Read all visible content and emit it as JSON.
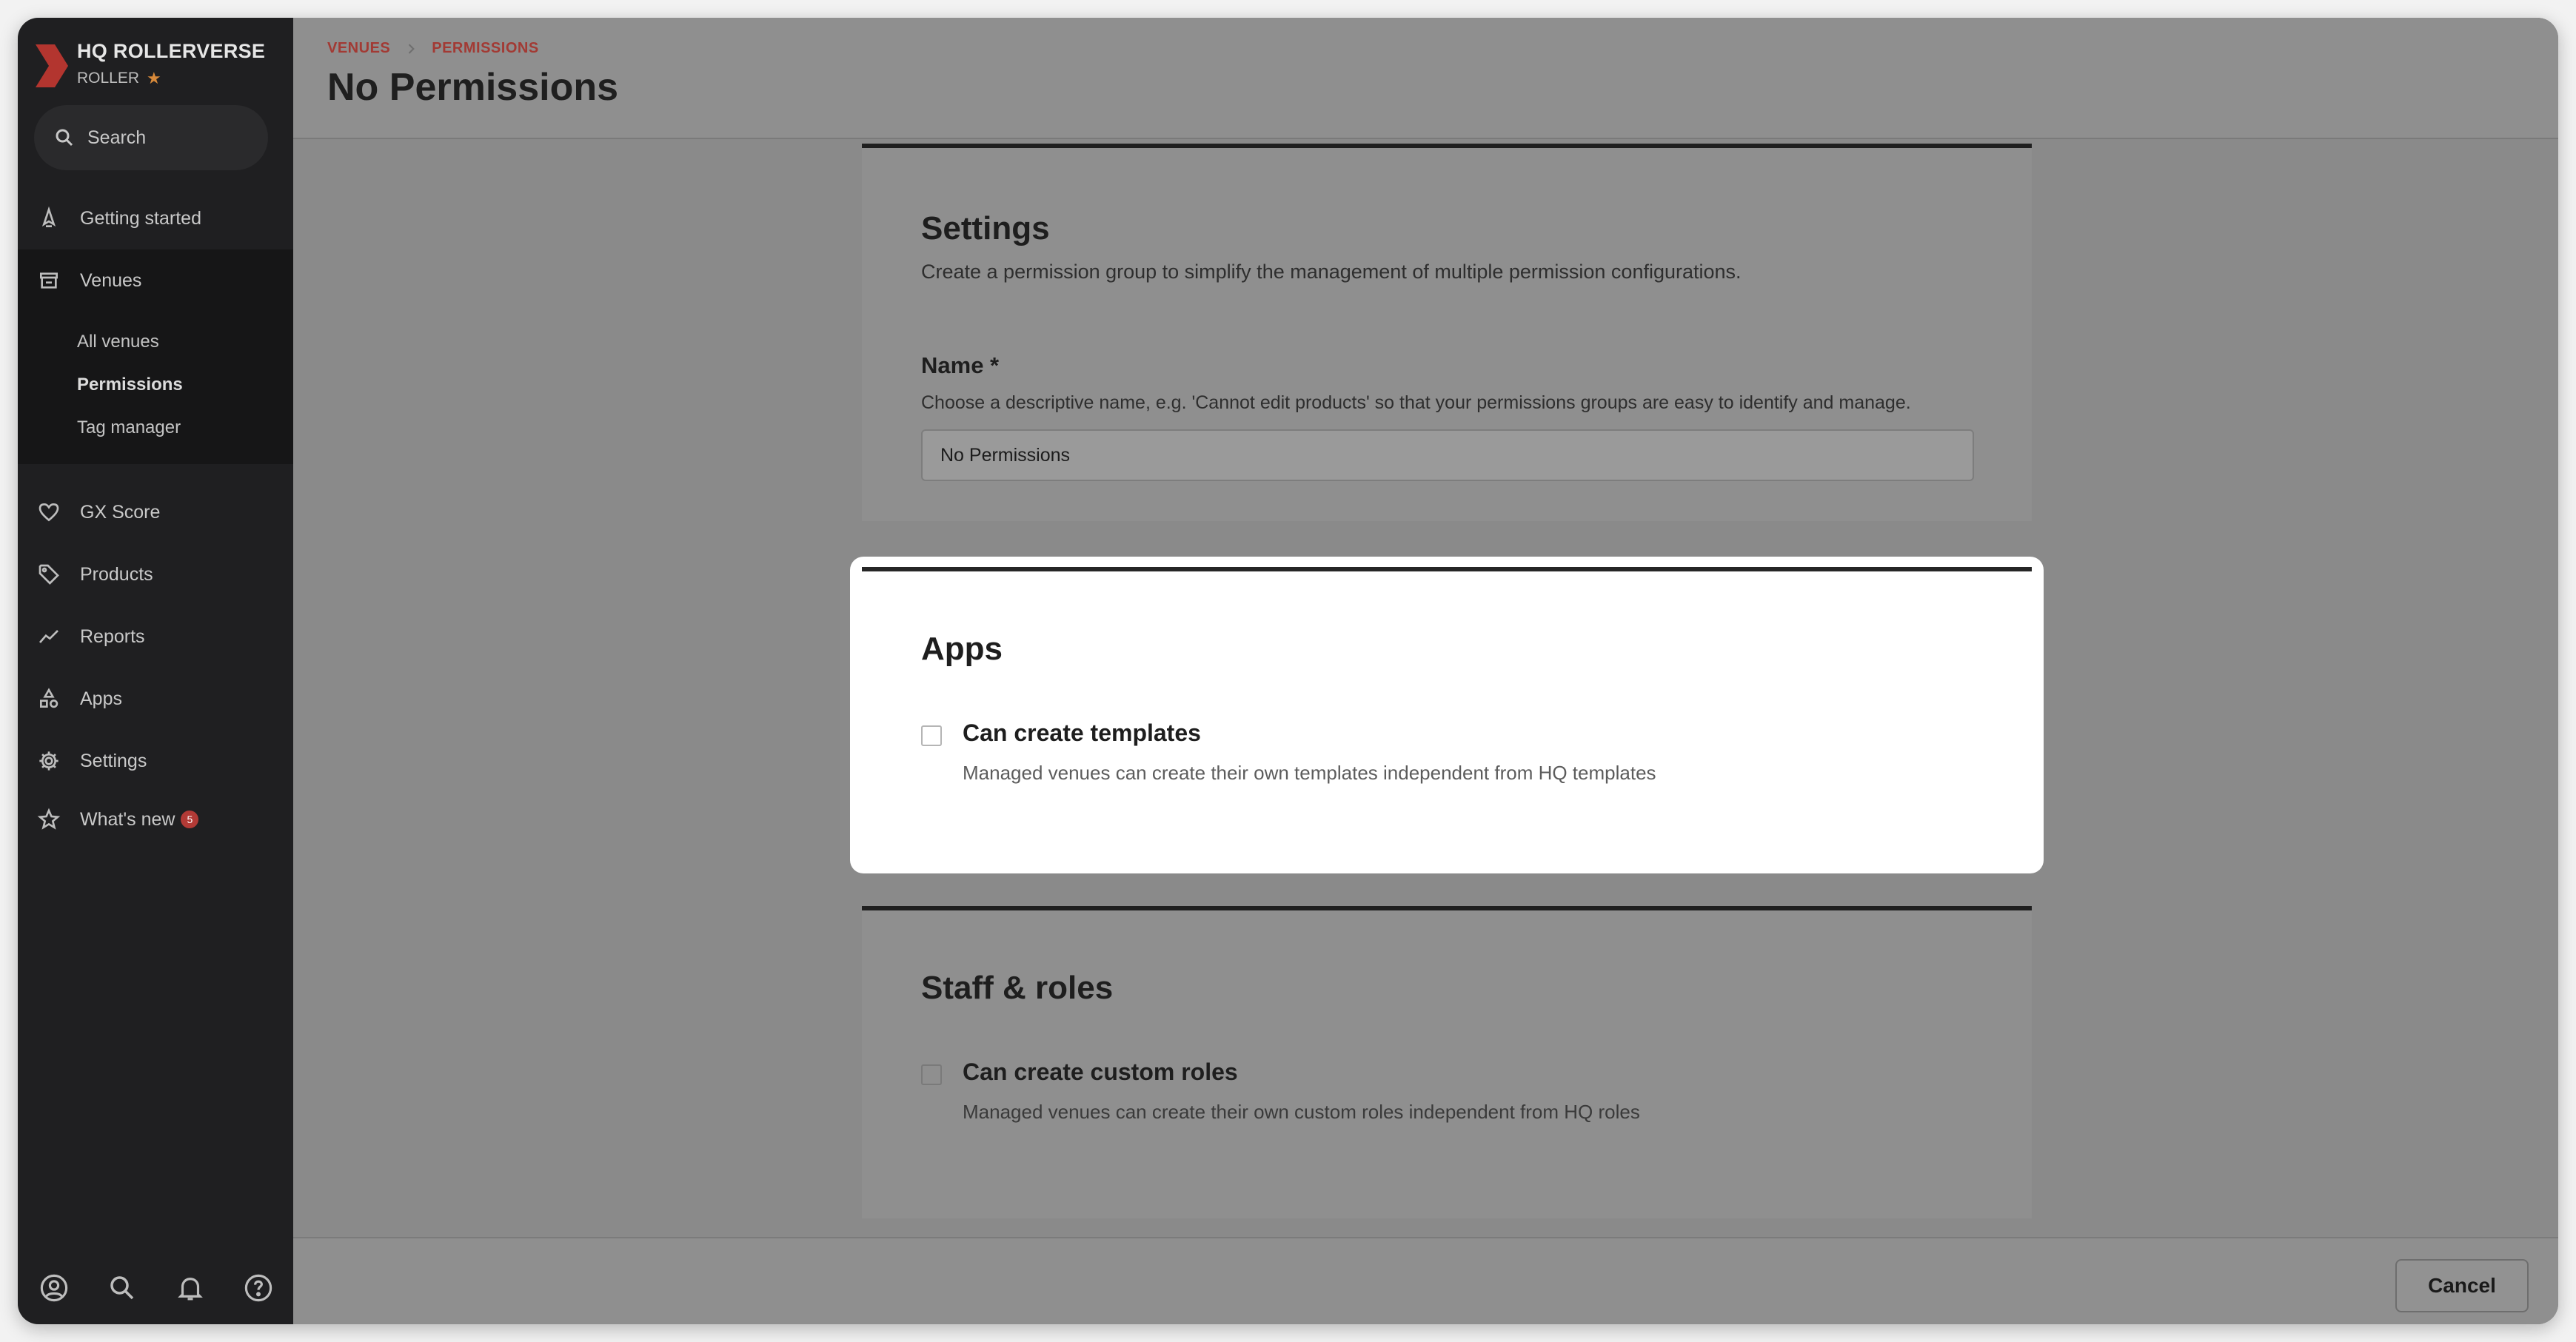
{
  "brand": {
    "name": "HQ ROLLERVERSE",
    "sub": "ROLLER"
  },
  "search": {
    "placeholder": "Search"
  },
  "nav": {
    "getting_started": "Getting started",
    "venues": "Venues",
    "venues_sub": [
      "All venues",
      "Permissions",
      "Tag manager"
    ],
    "gx_score": "GX Score",
    "products": "Products",
    "reports": "Reports",
    "apps": "Apps",
    "settings": "Settings",
    "whats_new": "What's new",
    "whats_new_count": "5"
  },
  "breadcrumb": [
    "VENUES",
    "PERMISSIONS"
  ],
  "page_title": "No Permissions",
  "settings_card": {
    "title": "Settings",
    "description": "Create a permission group to simplify the management of multiple permission configurations.",
    "name_label": "Name *",
    "name_help": "Choose a descriptive name, e.g. 'Cannot edit products' so that your permissions groups are easy to identify and manage.",
    "name_value": "No Permissions"
  },
  "apps_card": {
    "title": "Apps",
    "option_title": "Can create templates",
    "option_desc": "Managed venues can create their own templates independent from HQ templates",
    "checked": false
  },
  "staff_card": {
    "title": "Staff & roles",
    "option_title": "Can create custom roles",
    "option_desc": "Managed venues can create their own custom roles independent from HQ roles",
    "checked": false
  },
  "footer": {
    "cancel_label": "Cancel"
  },
  "colors": {
    "accent": "#a23a34",
    "sidebar": "#1f1f21",
    "badge": "#b23a36",
    "star": "#d88a3a"
  }
}
